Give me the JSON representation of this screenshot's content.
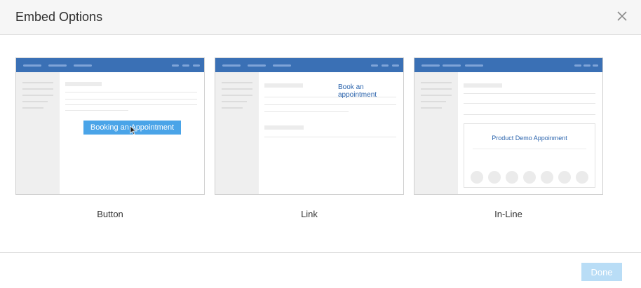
{
  "dialog": {
    "title": "Embed Options",
    "close_icon": "close-icon"
  },
  "options": [
    {
      "label": "Button",
      "preview_button_text": "Booking an Appointment"
    },
    {
      "label": "Link",
      "preview_link_text": "Book an appointment"
    },
    {
      "label": "In-Line",
      "preview_widget_title": "Product Demo Appoinment"
    }
  ],
  "footer": {
    "done_label": "Done"
  },
  "colors": {
    "accent": "#3a70b5",
    "button": "#4aa4e8",
    "done_disabled": "#b9ddf6"
  }
}
